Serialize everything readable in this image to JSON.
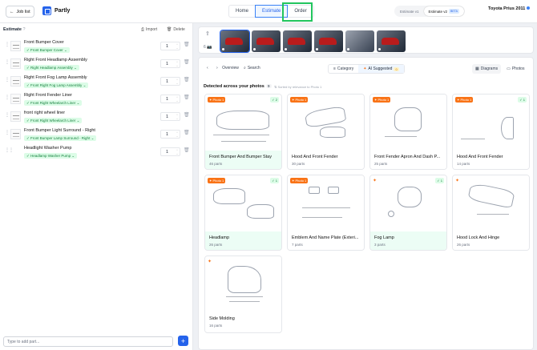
{
  "header": {
    "back_label": "Job list",
    "brand": "Partly",
    "tabs": [
      {
        "label": "Home",
        "active": false
      },
      {
        "label": "Estimate",
        "active": true
      },
      {
        "label": "Order",
        "active": false
      }
    ],
    "version_v1": "Estimate v1",
    "version_v2": "Estimate v2",
    "beta": "BETA",
    "vehicle": "Toyota Prius 2011"
  },
  "estimate": {
    "title": "Estimate",
    "import_label": "Import",
    "delete_label": "Delete",
    "items": [
      {
        "name": "Front Bumper Cover",
        "tag": "Front Bumper Cover",
        "qty": "1"
      },
      {
        "name": "Right Front Headlamp Assembly",
        "tag": "Right Headlamp Assembly",
        "qty": "1"
      },
      {
        "name": "Right Front Fog Lamp Assembly",
        "tag": "Front Right Fog Lamp Assembly",
        "qty": "1"
      },
      {
        "name": "Right Front Fender Liner",
        "tag": "Front Right Wheelarch Liner",
        "qty": "1"
      },
      {
        "name": "front right wheel liner",
        "tag": "Front Right Wheelarch Liner",
        "qty": "1"
      },
      {
        "name": "Front Bumper Light Surround - Right",
        "tag": "Front Bumper Lamp Surround - Right",
        "qty": "1"
      },
      {
        "name": "Headlight Washer Pump",
        "tag": "Headlamp Washer Pump",
        "qty": "1"
      }
    ],
    "add_placeholder": "Type to add part..."
  },
  "photos": {
    "count": "6"
  },
  "toolbar": {
    "overview": "Overview",
    "search": "Search",
    "category": "Category",
    "ai_suggested": "AI Suggested",
    "ai_count": "0",
    "diagrams": "Diagrams",
    "photos": "Photos"
  },
  "detected": {
    "title": "Detected across your photos",
    "count": "9",
    "sort_note": "Sorted by relevance to Photo 1"
  },
  "cards": [
    {
      "title": "Front Bumper And Bumper Stay",
      "parts": "46 parts",
      "photo": "Photo 1",
      "check": "2"
    },
    {
      "title": "Hood And Front Fender",
      "parts": "30 parts",
      "photo": "Photo 1",
      "check": ""
    },
    {
      "title": "Front Fender Apron And Dash P...",
      "parts": "25 parts",
      "photo": "Photo 1",
      "check": ""
    },
    {
      "title": "Hood And Front Fender",
      "parts": "14 parts",
      "photo": "Photo 1",
      "check": "1"
    },
    {
      "title": "Headlamp",
      "parts": "26 parts",
      "photo": "Photo 1",
      "check": "1"
    },
    {
      "title": "Emblem And Name Plate (Exteri...",
      "parts": "7 parts",
      "photo": "Photo 1",
      "check": ""
    },
    {
      "title": "Fog Lamp",
      "parts": "3 parts",
      "photo": "",
      "check": "1"
    },
    {
      "title": "Hood Lock And Hinge",
      "parts": "26 parts",
      "photo": "",
      "check": ""
    },
    {
      "title": "Side Molding",
      "parts": "16 parts",
      "photo": "",
      "check": ""
    }
  ]
}
